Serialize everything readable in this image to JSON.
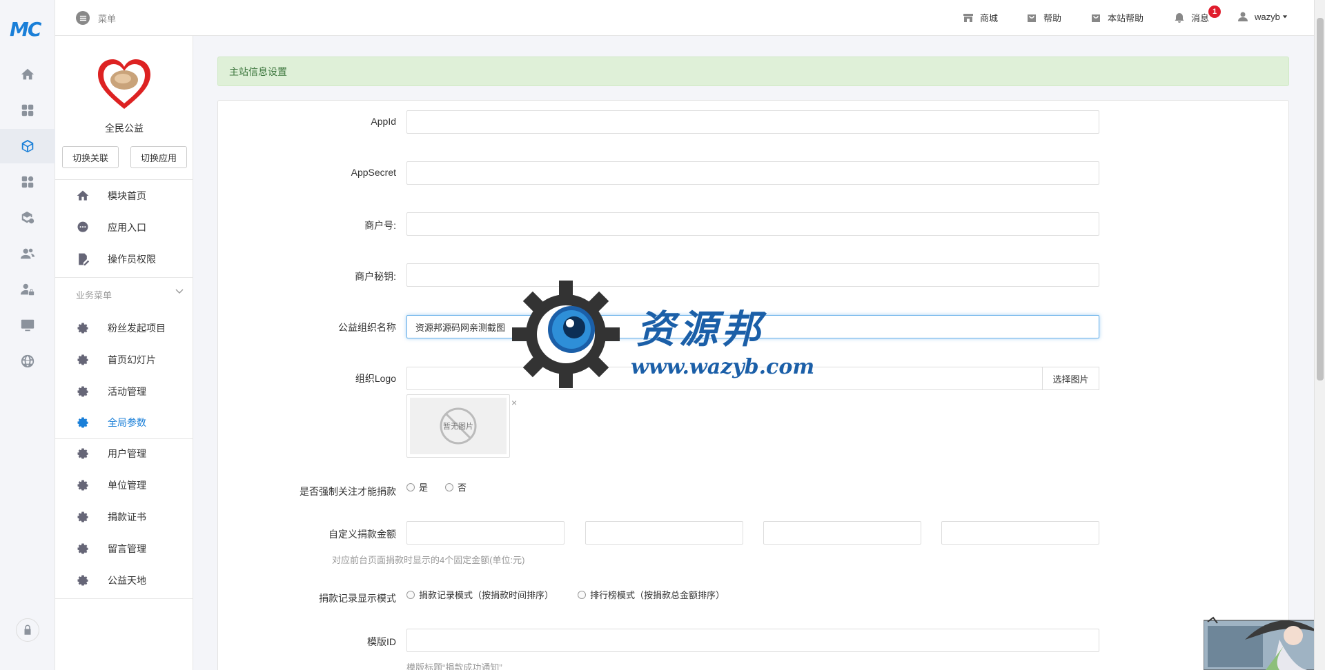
{
  "logo": "MC",
  "rail": {
    "icons": [
      "home-icon",
      "apps-grid-icon",
      "cube-icon",
      "modules-icon",
      "package-settings-icon",
      "users-icon",
      "user-lock-icon",
      "monitor-icon",
      "globe-icon",
      "lock-icon"
    ],
    "active_index": 2
  },
  "sidebar": {
    "app_name": "全民公益",
    "switch_link_label": "切换关联",
    "switch_app_label": "切换应用",
    "top_items": [
      {
        "label": "模块首页",
        "icon": "home-icon"
      },
      {
        "label": "应用入口",
        "icon": "chat-icon"
      },
      {
        "label": "操作员权限",
        "icon": "document-edit-icon"
      }
    ],
    "group_label": "业务菜单",
    "items": [
      {
        "label": "粉丝发起项目",
        "icon": "gear-icon"
      },
      {
        "label": "首页幻灯片",
        "icon": "gear-icon"
      },
      {
        "label": "活动管理",
        "icon": "gear-icon"
      },
      {
        "label": "全局参数",
        "icon": "gear-icon",
        "active": true
      },
      {
        "label": "用户管理",
        "icon": "gear-icon"
      },
      {
        "label": "单位管理",
        "icon": "gear-icon"
      },
      {
        "label": "捐款证书",
        "icon": "gear-icon"
      },
      {
        "label": "留言管理",
        "icon": "gear-icon"
      },
      {
        "label": "公益天地",
        "icon": "gear-icon"
      }
    ]
  },
  "header": {
    "menu_label": "菜单",
    "links": [
      {
        "label": "商城",
        "icon": "store-icon"
      },
      {
        "label": "帮助",
        "icon": "bag-icon"
      },
      {
        "label": "本站帮助",
        "icon": "bag-icon"
      },
      {
        "label": "消息",
        "icon": "bell-icon"
      }
    ],
    "message_count": "1",
    "username": "wazyb"
  },
  "main": {
    "alert": "主站信息设置",
    "form": {
      "appid_label": "AppId",
      "appid_value": "",
      "appsecret_label": "AppSecret",
      "appsecret_value": "",
      "merchant_no_label": "商户号:",
      "merchant_no_value": "",
      "merchant_key_label": "商户秘钥:",
      "merchant_key_value": "",
      "org_name_label": "公益组织名称",
      "org_name_value": "资源邦源码网亲测截图",
      "logo_label": "组织Logo",
      "logo_value": "",
      "choose_image_label": "选择图片",
      "no_image_label": "暂无图片",
      "remove_label": "×",
      "force_follow_label": "是否强制关注才能捐款",
      "yes_label": "是",
      "no_label": "否",
      "custom_amount_label": "自定义捐款金额",
      "custom_amount_values": [
        "",
        "",
        "",
        ""
      ],
      "custom_amount_help": "对应前台页面捐款时显示的4个固定金额(单位:元)",
      "record_mode_label": "捐款记录显示模式",
      "record_mode_option1": "捐款记录模式（按捐款时间排序）",
      "record_mode_option2": "排行榜模式（按捐款总金额排序）",
      "template_id_label": "模版ID",
      "template_id_value": "",
      "template_help": "模版标题“捐款成功通知”"
    }
  },
  "watermark": {
    "brand": "资源邦",
    "url": "www.wazyb.com"
  },
  "colors": {
    "accent": "#1a7fd8",
    "alert_bg": "#dff0d8",
    "alert_text": "#3c763d",
    "badge": "#e01c2c",
    "watermark": "#1b5fa8"
  }
}
